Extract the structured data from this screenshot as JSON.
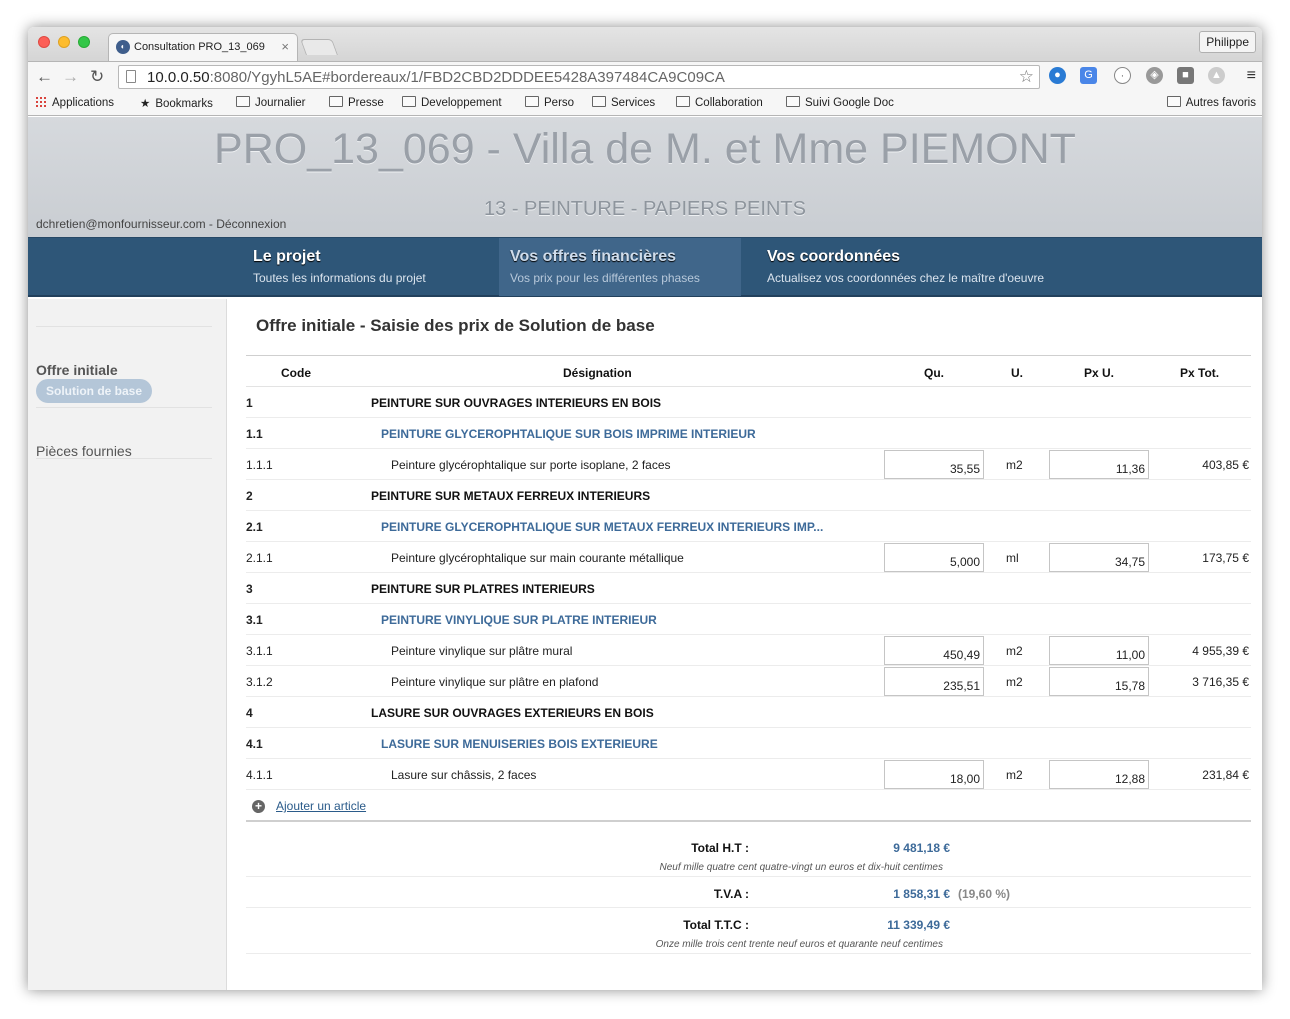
{
  "browser": {
    "tab_title": "Consultation PRO_13_069",
    "tab_close": "×",
    "profile": "Philippe",
    "url_host": "10.0.0.50",
    "url_rest": ":8080/YgyhL5AE#bordereaux/1/FBD2CBD2DDDEE5428A397484CA9C09CA",
    "bookmarks": [
      "Applications",
      "Bookmarks",
      "Journalier",
      "Presse",
      "Developpement",
      "Perso",
      "Services",
      "Collaboration",
      "Suivi Google Doc"
    ],
    "other_bookmarks": "Autres favoris"
  },
  "header": {
    "project_title": "PRO_13_069 - Villa de M. et Mme PIEMONT",
    "lot_title": "13 - PEINTURE - PAPIERS PEINTS",
    "user_email": "dchretien@monfournisseur.com",
    "separator": " - ",
    "logout": "Déconnexion"
  },
  "nav": [
    {
      "title": "Le projet",
      "subtitle": "Toutes les informations du projet"
    },
    {
      "title": "Vos offres financières",
      "subtitle": "Vos prix pour les différentes phases"
    },
    {
      "title": "Vos coordonnées",
      "subtitle": "Actualisez vos coordonnées chez le maître d'oeuvre"
    }
  ],
  "sidebar": {
    "section_title": "Offre initiale",
    "active_pill": "Solution de base",
    "item": "Pièces fournies"
  },
  "main": {
    "heading": "Offre initiale - Saisie des prix de Solution de base",
    "columns": {
      "code": "Code",
      "designation": "Désignation",
      "qty": "Qu.",
      "unit": "U.",
      "unit_price": "Px U.",
      "total": "Px Tot."
    },
    "rows": [
      {
        "level": 1,
        "code": "1",
        "designation": "PEINTURE SUR OUVRAGES INTERIEURS EN BOIS"
      },
      {
        "level": 2,
        "code": "1.1",
        "designation": "PEINTURE GLYCEROPHTALIQUE SUR BOIS IMPRIME INTERIEUR"
      },
      {
        "level": 3,
        "code": "1.1.1",
        "designation": "Peinture glycérophtalique sur porte isoplane, 2 faces",
        "qty": "35,55",
        "unit": "m2",
        "unit_price": "11,36",
        "total": "403,85 €"
      },
      {
        "level": 1,
        "code": "2",
        "designation": "PEINTURE SUR METAUX FERREUX INTERIEURS"
      },
      {
        "level": 2,
        "code": "2.1",
        "designation": "PEINTURE GLYCEROPHTALIQUE SUR METAUX FERREUX INTERIEURS IMP..."
      },
      {
        "level": 3,
        "code": "2.1.1",
        "designation": "Peinture glycérophtalique sur main courante métallique",
        "qty": "5,000",
        "unit": "ml",
        "unit_price": "34,75",
        "total": "173,75 €"
      },
      {
        "level": 1,
        "code": "3",
        "designation": "PEINTURE SUR PLATRES INTERIEURS"
      },
      {
        "level": 2,
        "code": "3.1",
        "designation": "PEINTURE VINYLIQUE SUR PLATRE INTERIEUR"
      },
      {
        "level": 3,
        "code": "3.1.1",
        "designation": "Peinture vinylique sur plâtre mural",
        "qty": "450,49",
        "unit": "m2",
        "unit_price": "11,00",
        "total": "4 955,39 €"
      },
      {
        "level": 3,
        "code": "3.1.2",
        "designation": "Peinture vinylique sur plâtre en plafond",
        "qty": "235,51",
        "unit": "m2",
        "unit_price": "15,78",
        "total": "3 716,35 €"
      },
      {
        "level": 1,
        "code": "4",
        "designation": "LASURE SUR OUVRAGES EXTERIEURS EN BOIS"
      },
      {
        "level": 2,
        "code": "4.1",
        "designation": "LASURE SUR MENUISERIES BOIS EXTERIEURE"
      },
      {
        "level": 3,
        "code": "4.1.1",
        "designation": "Lasure sur châssis, 2 faces",
        "qty": "18,00",
        "unit": "m2",
        "unit_price": "12,88",
        "total": "231,84 €"
      }
    ],
    "add_article": "Ajouter un article",
    "totals": {
      "ht_label": "Total H.T :",
      "ht_value": "9 481,18 €",
      "ht_words": "Neuf mille quatre cent quatre-vingt un euros et dix-huit centimes",
      "tva_label": "T.V.A :",
      "tva_value": "1 858,31 €",
      "tva_rate": "(19,60 %)",
      "ttc_label": "Total T.T.C :",
      "ttc_value": "11 339,49 €",
      "ttc_words": "Onze mille trois cent trente neuf euros et quarante neuf centimes"
    }
  },
  "colors": {
    "nav_bg": "#2e5678",
    "nav_active": "#40668a",
    "accent_blue": "#3d6a99",
    "header_bg": "#cfd3d8"
  }
}
